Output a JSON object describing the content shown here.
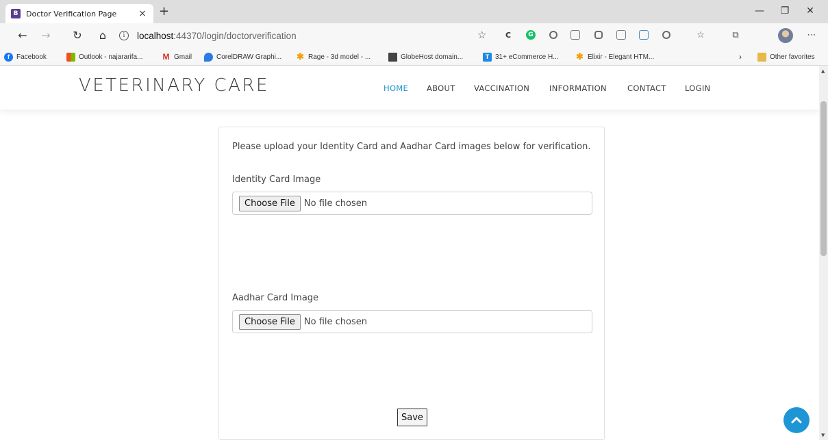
{
  "browser": {
    "tab_title": "Doctor Verification Page",
    "tab_favicon_letter": "B",
    "tab_close": "×",
    "new_tab": "+",
    "url_host": "localhost",
    "url_path": ":44370/login/doctorverification",
    "other_favorites": "Other favorites",
    "bookmarks": [
      {
        "label": "Facebook",
        "color": "#1877f2",
        "glyph": "f"
      },
      {
        "label": "Outlook - najararifa...",
        "color": "#f25022",
        "glyph": ""
      },
      {
        "label": "Gmail",
        "color": "#d93025",
        "glyph": "M"
      },
      {
        "label": "CorelDRAW Graphi...",
        "color": "#2c7be5",
        "glyph": ""
      },
      {
        "label": "Rage - 3d model - ...",
        "color": "#f59e0b",
        "glyph": "✱"
      },
      {
        "label": "GlobeHost domain...",
        "color": "#444444",
        "glyph": ""
      },
      {
        "label": "31+ eCommerce H...",
        "color": "#1e88e5",
        "glyph": "T"
      },
      {
        "label": "Elixir - Elegant HTM...",
        "color": "#f59e0b",
        "glyph": "✱"
      }
    ]
  },
  "site": {
    "logo": "VETERINARY CARE",
    "nav": [
      "HOME",
      "ABOUT",
      "VACCINATION",
      "INFORMATION",
      "CONTACT",
      "LOGIN"
    ],
    "active_nav": "HOME",
    "accent_color": "#1a96c9"
  },
  "form": {
    "intro": "Please upload your Identity Card and Aadhar Card images below for verification.",
    "identity_label": "Identity Card Image",
    "aadhar_label": "Aadhar Card Image",
    "choose_file": "Choose File",
    "no_file": "No file chosen",
    "save": "Save"
  }
}
